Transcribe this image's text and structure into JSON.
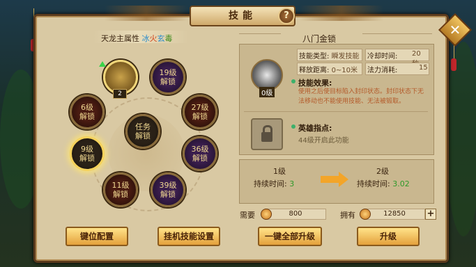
{
  "window": {
    "title": "技能",
    "help_label": "?",
    "close_label": "✕"
  },
  "left": {
    "attribute_label": "天龙主属性",
    "attribute_ice": "冰",
    "attribute_fire": "火",
    "attribute_dark": "玄",
    "attribute_poison": "毒",
    "nodes": [
      {
        "name": "active-skill",
        "label": "",
        "badge": "2"
      },
      {
        "name": "node-19",
        "label1": "19级",
        "label2": "解锁"
      },
      {
        "name": "node-6",
        "label1": "6级",
        "label2": "解锁"
      },
      {
        "name": "node-27",
        "label1": "27级",
        "label2": "解锁"
      },
      {
        "name": "node-task",
        "label1": "任务",
        "label2": "解锁"
      },
      {
        "name": "node-9",
        "label1": "9级",
        "label2": "解锁"
      },
      {
        "name": "node-36",
        "label1": "36级",
        "label2": "解锁"
      },
      {
        "name": "node-11",
        "label1": "11级",
        "label2": "解锁"
      },
      {
        "name": "node-39",
        "label1": "39级",
        "label2": "解锁"
      }
    ],
    "buttons": {
      "key_config": "键位配置",
      "auto_skill": "挂机技能设置"
    }
  },
  "right": {
    "skill_name": "八门金锁",
    "icon_level": "0级",
    "skill_type_label": "技能类型:",
    "skill_type_value": "瞬发技能",
    "cooldown_label": "冷却时间:",
    "cooldown_value": "20秒",
    "range_label": "释放距离:",
    "range_value": "0~10米",
    "mana_label": "法力消耗:",
    "mana_value": "15",
    "effect_title": "技能效果:",
    "effect_desc": "使用之后使目标陷入封印状态。封印状态下无法移动也不能使用技能、无法被锻取。",
    "hero_title": "英雄指点:",
    "hero_tip": "44级开启此功能",
    "level_from": "1级",
    "level_to": "2级",
    "duration_label": "持续时间:",
    "duration_from": "3",
    "duration_to": "3.02",
    "need_label": "需要",
    "need_value": "800",
    "have_label": "拥有",
    "have_value": "12850",
    "plus_label": "+",
    "btn_upgrade_all": "一键全部升级",
    "btn_upgrade": "升级"
  },
  "colors": {
    "ice": "#2a8ccc",
    "fire": "#d0461e",
    "dark": "#3e8a1c",
    "accent": "#f3a529",
    "gain": "#2f9a2a"
  }
}
